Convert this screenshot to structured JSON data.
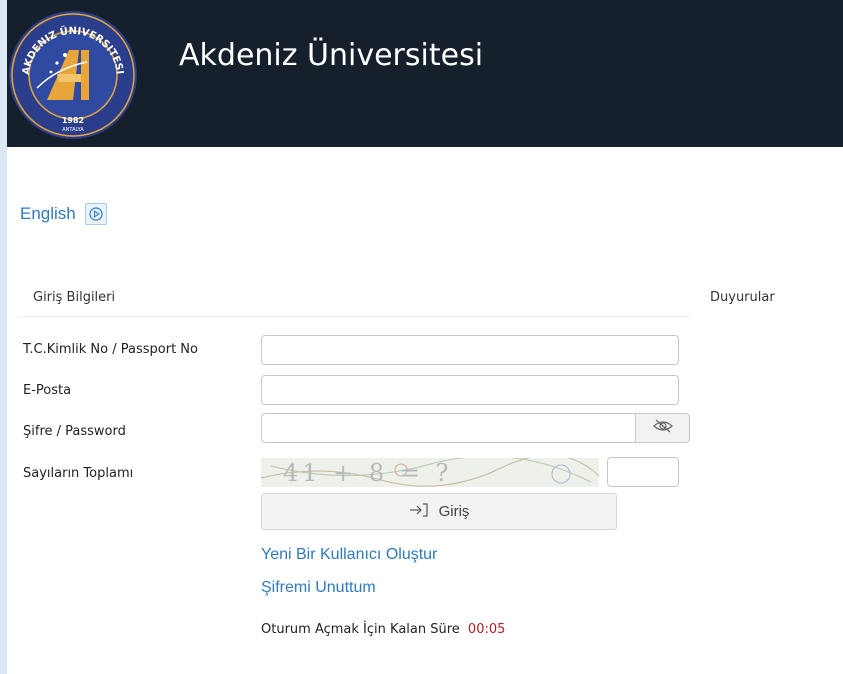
{
  "header": {
    "title": "Akdeniz Üniversitesi",
    "logo": {
      "top_text": "AKDENIZ ÜNIVERSITESI",
      "year": "1982",
      "city": "ANTALYA",
      "colors": {
        "ring": "#2a3e8c",
        "accent": "#e8a53a"
      }
    }
  },
  "language": {
    "link": "English",
    "icon": "play-circle-icon"
  },
  "login": {
    "section_title": "Giriş Bilgileri",
    "fields": {
      "tc_label": "T.C.Kimlik No / Passport No",
      "tc_value": "",
      "email_label": "E-Posta",
      "email_value": "",
      "password_label": "Şifre / Password",
      "password_value": "",
      "password_toggle_icon": "eye-off-icon",
      "captcha_label": "Sayıların Toplamı",
      "captcha_text": "41 + 8 = ?",
      "captcha_answer": ""
    },
    "submit_label": "Giriş",
    "submit_icon": "sign-in-icon",
    "links": {
      "register": "Yeni Bir Kullanıcı Oluştur",
      "forgot": "Şifremi Unuttum"
    },
    "timer": {
      "label": "Oturum Açmak İçin Kalan Süre",
      "value": "00:05"
    }
  },
  "announcements": {
    "title": "Duyurular"
  },
  "colors": {
    "header_bg": "#16202d",
    "link": "#2f7bbd",
    "timer": "#b02020"
  }
}
